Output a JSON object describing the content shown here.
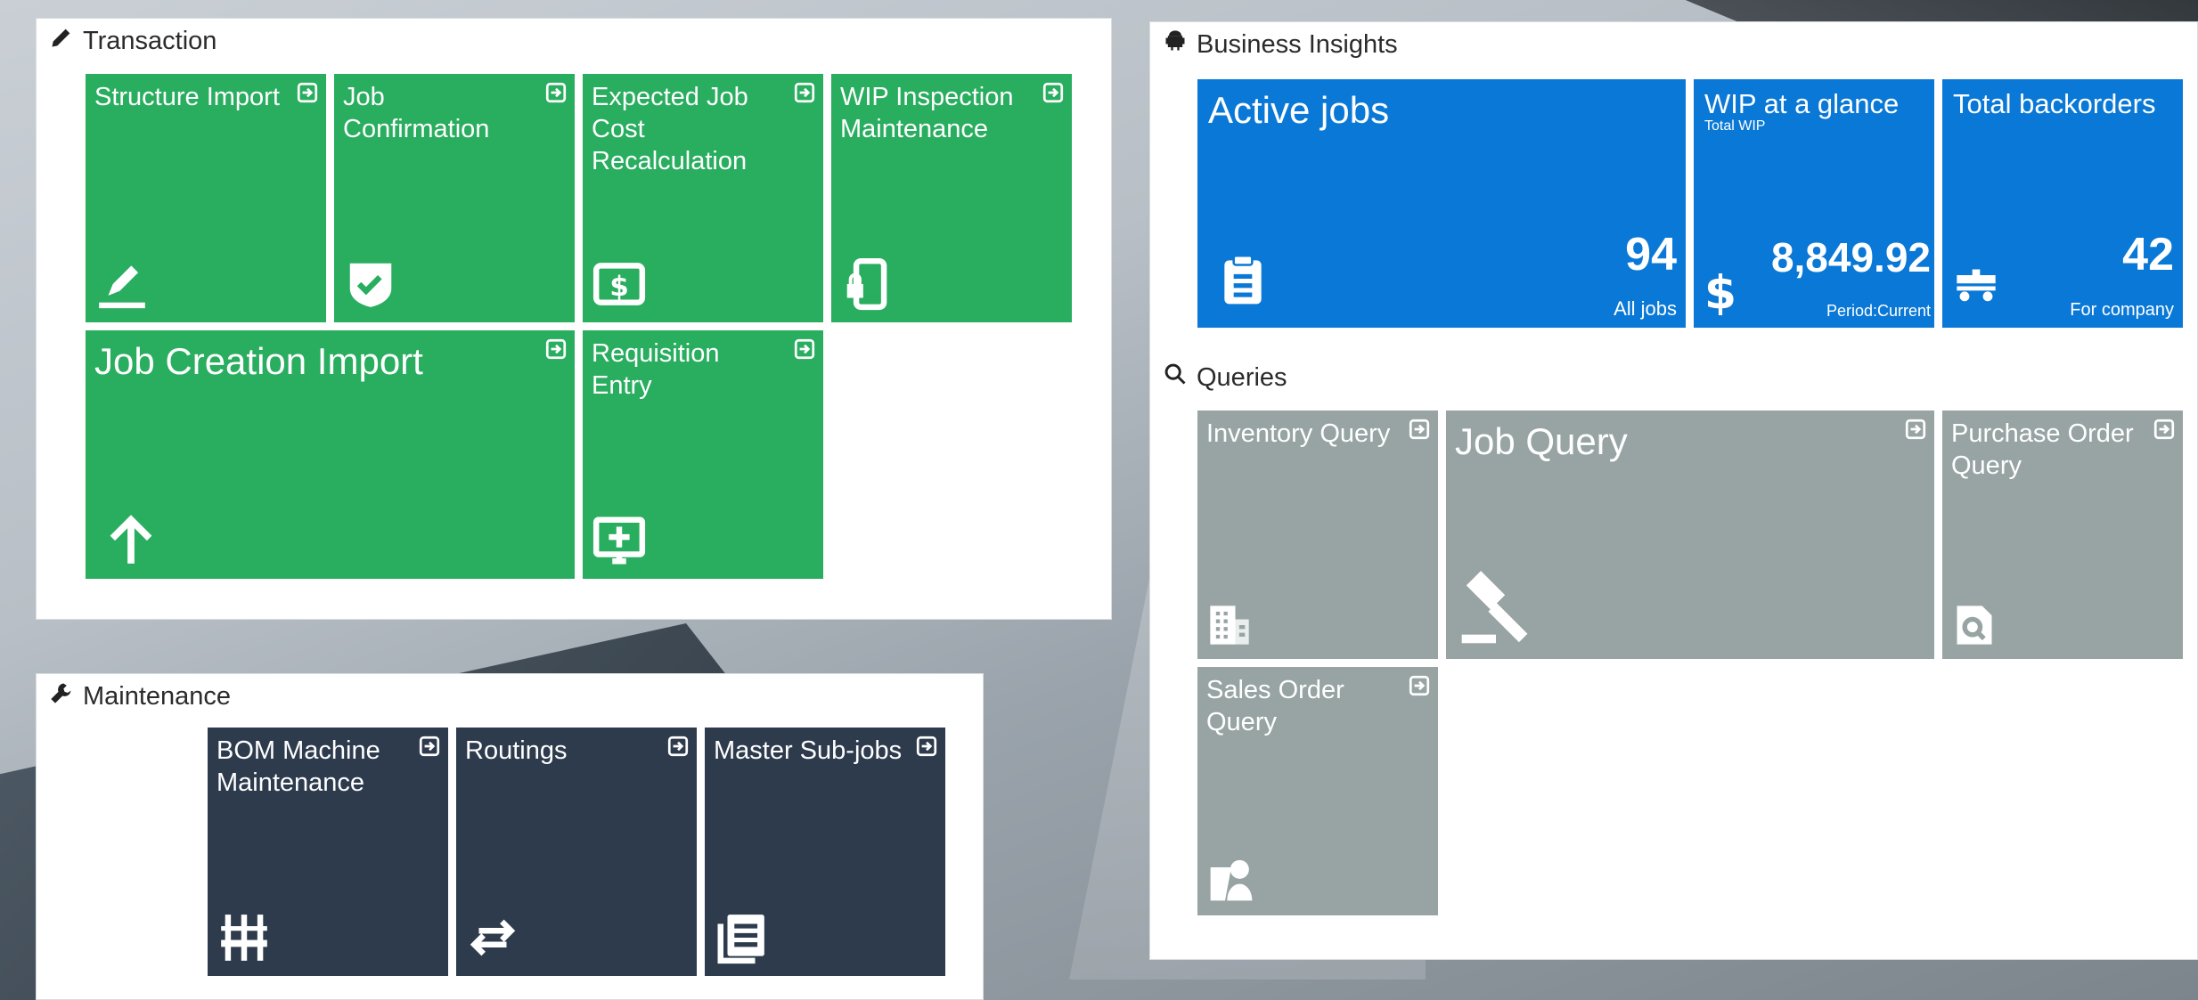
{
  "transaction": {
    "title": "Transaction",
    "tiles": [
      {
        "label": "Structure Import",
        "icon": "pencil-icon"
      },
      {
        "label": "Job Confirmation",
        "icon": "shield-check-icon"
      },
      {
        "label": "Expected Job Cost Recalculation",
        "icon": "dollar-bill-icon"
      },
      {
        "label": "WIP Inspection Maintenance",
        "icon": "mobile-lock-icon"
      },
      {
        "label": "Job Creation Import",
        "icon": "arrow-up-icon"
      },
      {
        "label": "Requisition Entry",
        "icon": "monitor-plus-icon"
      }
    ]
  },
  "maintenance": {
    "title": "Maintenance",
    "tiles": [
      {
        "label": "BOM Machine Maintenance",
        "icon": "sliders-icon"
      },
      {
        "label": "Routings",
        "icon": "swap-arrows-icon"
      },
      {
        "label": "Master Sub-jobs",
        "icon": "document-list-icon"
      }
    ]
  },
  "insights": {
    "title": "Business Insights",
    "kpis": [
      {
        "title": "Active jobs",
        "sub": "",
        "value": "94",
        "unit": "All jobs",
        "icon": "clipboard-icon"
      },
      {
        "title": "WIP at a glance",
        "sub": "Total WIP",
        "value": "8,849.92",
        "unit": "Period:Current",
        "icon": "dollar-sign-icon"
      },
      {
        "title": "Total backorders",
        "sub": "",
        "value": "42",
        "unit": "For company",
        "icon": "truck-icon"
      }
    ]
  },
  "queries": {
    "title": "Queries",
    "tiles": [
      {
        "label": "Inventory Query",
        "icon": "building-icon"
      },
      {
        "label": "Job Query",
        "icon": "gavel-icon"
      },
      {
        "label": "Purchase Order Query",
        "icon": "document-search-icon"
      },
      {
        "label": "Sales Order Query",
        "icon": "customer-icon"
      }
    ]
  },
  "colors": {
    "transaction": "#29ad5f",
    "insights": "#0a78d6",
    "queries": "#97a4a3",
    "maintenance": "#2d3b4d"
  }
}
